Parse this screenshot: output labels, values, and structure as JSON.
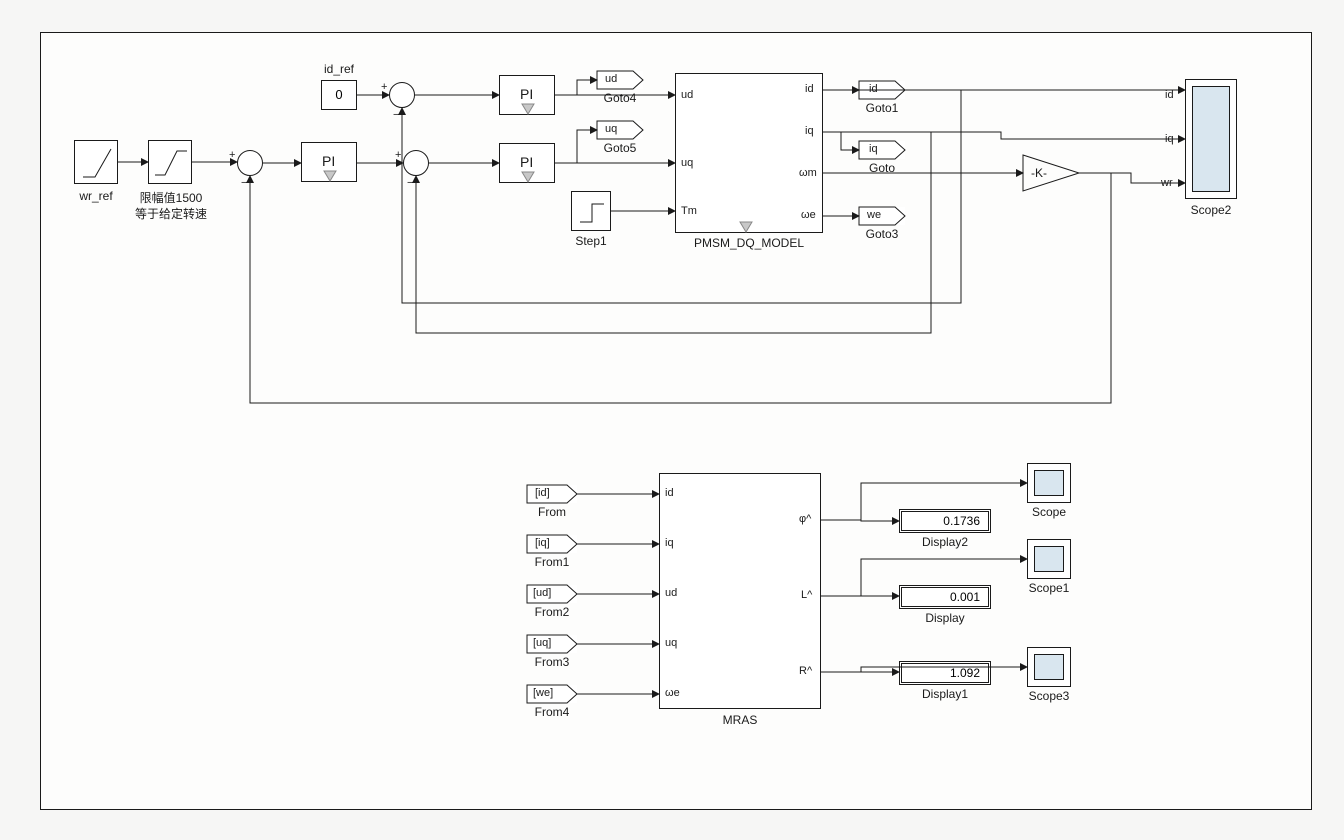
{
  "blocks": {
    "wr_ref": {
      "label": "wr_ref"
    },
    "sat": {
      "label1": "限幅值1500",
      "label2": "等于给定转速"
    },
    "id_ref": {
      "label": "id_ref",
      "value": "0"
    },
    "pi_speed": {
      "text": "PI"
    },
    "pi_d": {
      "text": "PI"
    },
    "pi_q": {
      "text": "PI"
    },
    "step": {
      "label": "Step1"
    },
    "pmsm": {
      "label": "PMSM_DQ_MODEL",
      "in": [
        "ud",
        "uq",
        "Tm"
      ],
      "out": [
        "id",
        "iq",
        "ωm",
        "ωe"
      ]
    },
    "gain": {
      "text": "-K-"
    },
    "scope2": {
      "label": "Scope2",
      "ports": [
        "id",
        "iq",
        "wr"
      ]
    },
    "goto": {
      "ud": "ud",
      "uq": "uq",
      "id": "id",
      "iq": "iq",
      "we": "we",
      "g4": "Goto4",
      "g5": "Goto5",
      "g1": "Goto1",
      "g": "Goto",
      "g3": "Goto3"
    },
    "from": {
      "id": "[id]",
      "iq": "[iq]",
      "ud": "[ud]",
      "uq": "[uq]",
      "we": "[we]",
      "f": "From",
      "f1": "From1",
      "f2": "From2",
      "f3": "From3",
      "f4": "From4"
    },
    "mras": {
      "label": "MRAS",
      "in": [
        "id",
        "iq",
        "ud",
        "uq",
        "ωe"
      ],
      "out": [
        "φ^",
        "L^",
        "R^"
      ]
    },
    "display": {
      "d2": {
        "label": "Display2",
        "value": "0.1736"
      },
      "d": {
        "label": "Display",
        "value": "0.001"
      },
      "d1": {
        "label": "Display1",
        "value": "1.092"
      }
    },
    "scopes": {
      "s": "Scope",
      "s1": "Scope1",
      "s3": "Scope3"
    }
  }
}
